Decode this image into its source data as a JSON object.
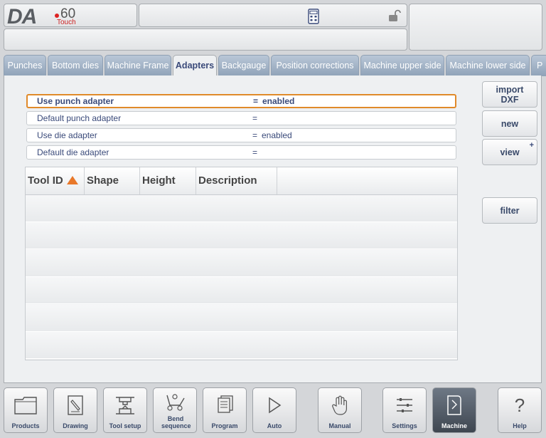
{
  "header": {
    "logo_da": "DA",
    "logo_num": "60",
    "logo_touch": "Touch"
  },
  "tabs": [
    {
      "label": "Punches"
    },
    {
      "label": "Bottom dies"
    },
    {
      "label": "Machine Frame"
    },
    {
      "label": "Adapters",
      "active": true
    },
    {
      "label": "Backgauge"
    },
    {
      "label": "Position corrections"
    },
    {
      "label": "Machine upper side"
    },
    {
      "label": "Machine lower side"
    },
    {
      "label": "P"
    }
  ],
  "params": [
    {
      "label": "Use punch adapter",
      "eq": "=",
      "value": "enabled"
    },
    {
      "label": "Default punch adapter",
      "eq": "=",
      "value": ""
    },
    {
      "label": "Use die adapter",
      "eq": "=",
      "value": "enabled"
    },
    {
      "label": "Default die adapter",
      "eq": "=",
      "value": ""
    }
  ],
  "table": {
    "columns": [
      "Tool ID",
      "Shape",
      "Height",
      "Description",
      ""
    ],
    "rows": [
      [],
      [],
      [],
      [],
      [],
      []
    ]
  },
  "side_buttons": {
    "import_dxf": "import\nDXF",
    "new": "new",
    "view": "view",
    "view_plus": "+",
    "filter": "filter"
  },
  "nav": [
    {
      "label": "Products",
      "icon": "folder-icon"
    },
    {
      "label": "Drawing",
      "icon": "drawing-icon"
    },
    {
      "label": "Tool setup",
      "icon": "tool-setup-icon"
    },
    {
      "label": "Bend sequence",
      "icon": "bend-sequence-icon"
    },
    {
      "label": "Program",
      "icon": "program-icon"
    },
    {
      "label": "Auto",
      "icon": "play-icon"
    },
    {
      "label": "Manual",
      "icon": "hand-icon"
    },
    {
      "label": "Settings",
      "icon": "settings-icon"
    },
    {
      "label": "Machine",
      "icon": "machine-icon",
      "active": true
    },
    {
      "label": "Help",
      "icon": "help-icon"
    }
  ],
  "colors": {
    "accent": "#e8782a",
    "tab_blue": "#8fa2b8",
    "text_blue": "#3a4a7a"
  }
}
